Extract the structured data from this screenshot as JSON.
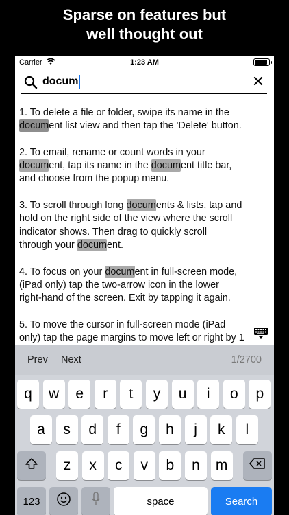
{
  "headline": {
    "line1": "Sparse on features but",
    "line2": "well thought out"
  },
  "status_bar": {
    "carrier": "Carrier",
    "time": "1:23 AM"
  },
  "search": {
    "query": "docum"
  },
  "document": {
    "items": [
      {
        "lines": [
          [
            {
              "t": "1. To delete a file or folder, swipe its name in the"
            }
          ],
          [
            {
              "t": "docum",
              "hl": "current"
            },
            {
              "t": "ent list view and then tap the 'Delete' button."
            }
          ]
        ]
      },
      {
        "lines": [
          [
            {
              "t": "2. To email, rename or count words in your"
            }
          ],
          [
            {
              "t": "docum",
              "hl": "match"
            },
            {
              "t": "ent, tap its name in the "
            },
            {
              "t": "docum",
              "hl": "match"
            },
            {
              "t": "ent title bar,"
            }
          ],
          [
            {
              "t": "and choose from the popup menu."
            }
          ]
        ]
      },
      {
        "lines": [
          [
            {
              "t": "3. To scroll through long "
            },
            {
              "t": "docum",
              "hl": "match"
            },
            {
              "t": "ents & lists, tap and"
            }
          ],
          [
            {
              "t": "hold on the right side of the view where the scroll"
            }
          ],
          [
            {
              "t": "indicator shows. Then drag to quickly scroll"
            }
          ],
          [
            {
              "t": "through your "
            },
            {
              "t": "docum",
              "hl": "match"
            },
            {
              "t": "ent."
            }
          ]
        ]
      },
      {
        "lines": [
          [
            {
              "t": "4. To focus on your "
            },
            {
              "t": "docum",
              "hl": "match"
            },
            {
              "t": "ent in full-screen mode,"
            }
          ],
          [
            {
              "t": "(iPad only) tap the two-arrow icon in the lower"
            }
          ],
          [
            {
              "t": "right-hand of the screen. Exit by tapping it again."
            }
          ]
        ]
      },
      {
        "lines": [
          [
            {
              "t": "5. To move the cursor in full-screen mode (iPad"
            }
          ],
          [
            {
              "t": "only) tap the page margins to move left or right by 1"
            }
          ]
        ]
      }
    ]
  },
  "find_toolbar": {
    "prev": "Prev",
    "next": "Next",
    "counter": "1/2700"
  },
  "keyboard": {
    "row1": [
      "q",
      "w",
      "e",
      "r",
      "t",
      "y",
      "u",
      "i",
      "o",
      "p"
    ],
    "row2": [
      "a",
      "s",
      "d",
      "f",
      "g",
      "h",
      "j",
      "k",
      "l"
    ],
    "row3": [
      "z",
      "x",
      "c",
      "v",
      "b",
      "n",
      "m"
    ],
    "numbers_key": "123",
    "space_key": "space",
    "search_key": "Search"
  },
  "icons": {
    "search": "search-icon",
    "clear": "close-icon",
    "wifi": "wifi-icon",
    "battery": "battery-icon",
    "keyboard_dismiss": "keyboard-dismiss-icon",
    "shift": "shift-icon",
    "backspace": "backspace-icon",
    "emoji": "emoji-icon",
    "microphone": "microphone-icon"
  },
  "colors": {
    "match_highlight": "#a9a9a9",
    "current_highlight": "#8e8e8e",
    "search_key": "#1a7cf2",
    "caret": "#1a73e8"
  }
}
